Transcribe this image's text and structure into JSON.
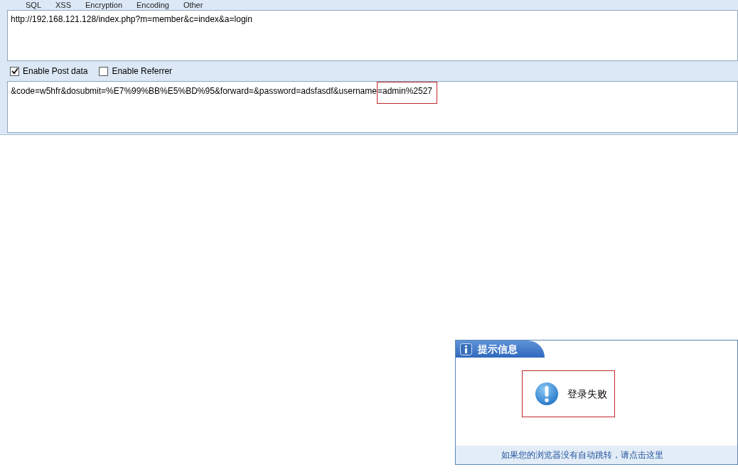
{
  "menu": [
    {
      "label": "SQL"
    },
    {
      "label": "XSS"
    },
    {
      "label": "Encryption"
    },
    {
      "label": "Encoding"
    },
    {
      "label": "Other"
    }
  ],
  "url_field": {
    "value": "http://192.168.121.128/index.php?m=member&c=index&a=login"
  },
  "options": [
    {
      "label": "Enable Post data",
      "checked": true
    },
    {
      "label": "Enable Referrer",
      "checked": false
    }
  ],
  "post_data": {
    "text": "&code=w5hfr&dosubmit=%E7%99%BB%E5%BD%95&forward=&password=adsfasdf&username",
    "highlighted_text": "=admin%2527"
  },
  "dialog": {
    "title": "提示信息",
    "message": "登录失败",
    "link": "如果您的浏览器没有自动跳转，请点击这里"
  }
}
